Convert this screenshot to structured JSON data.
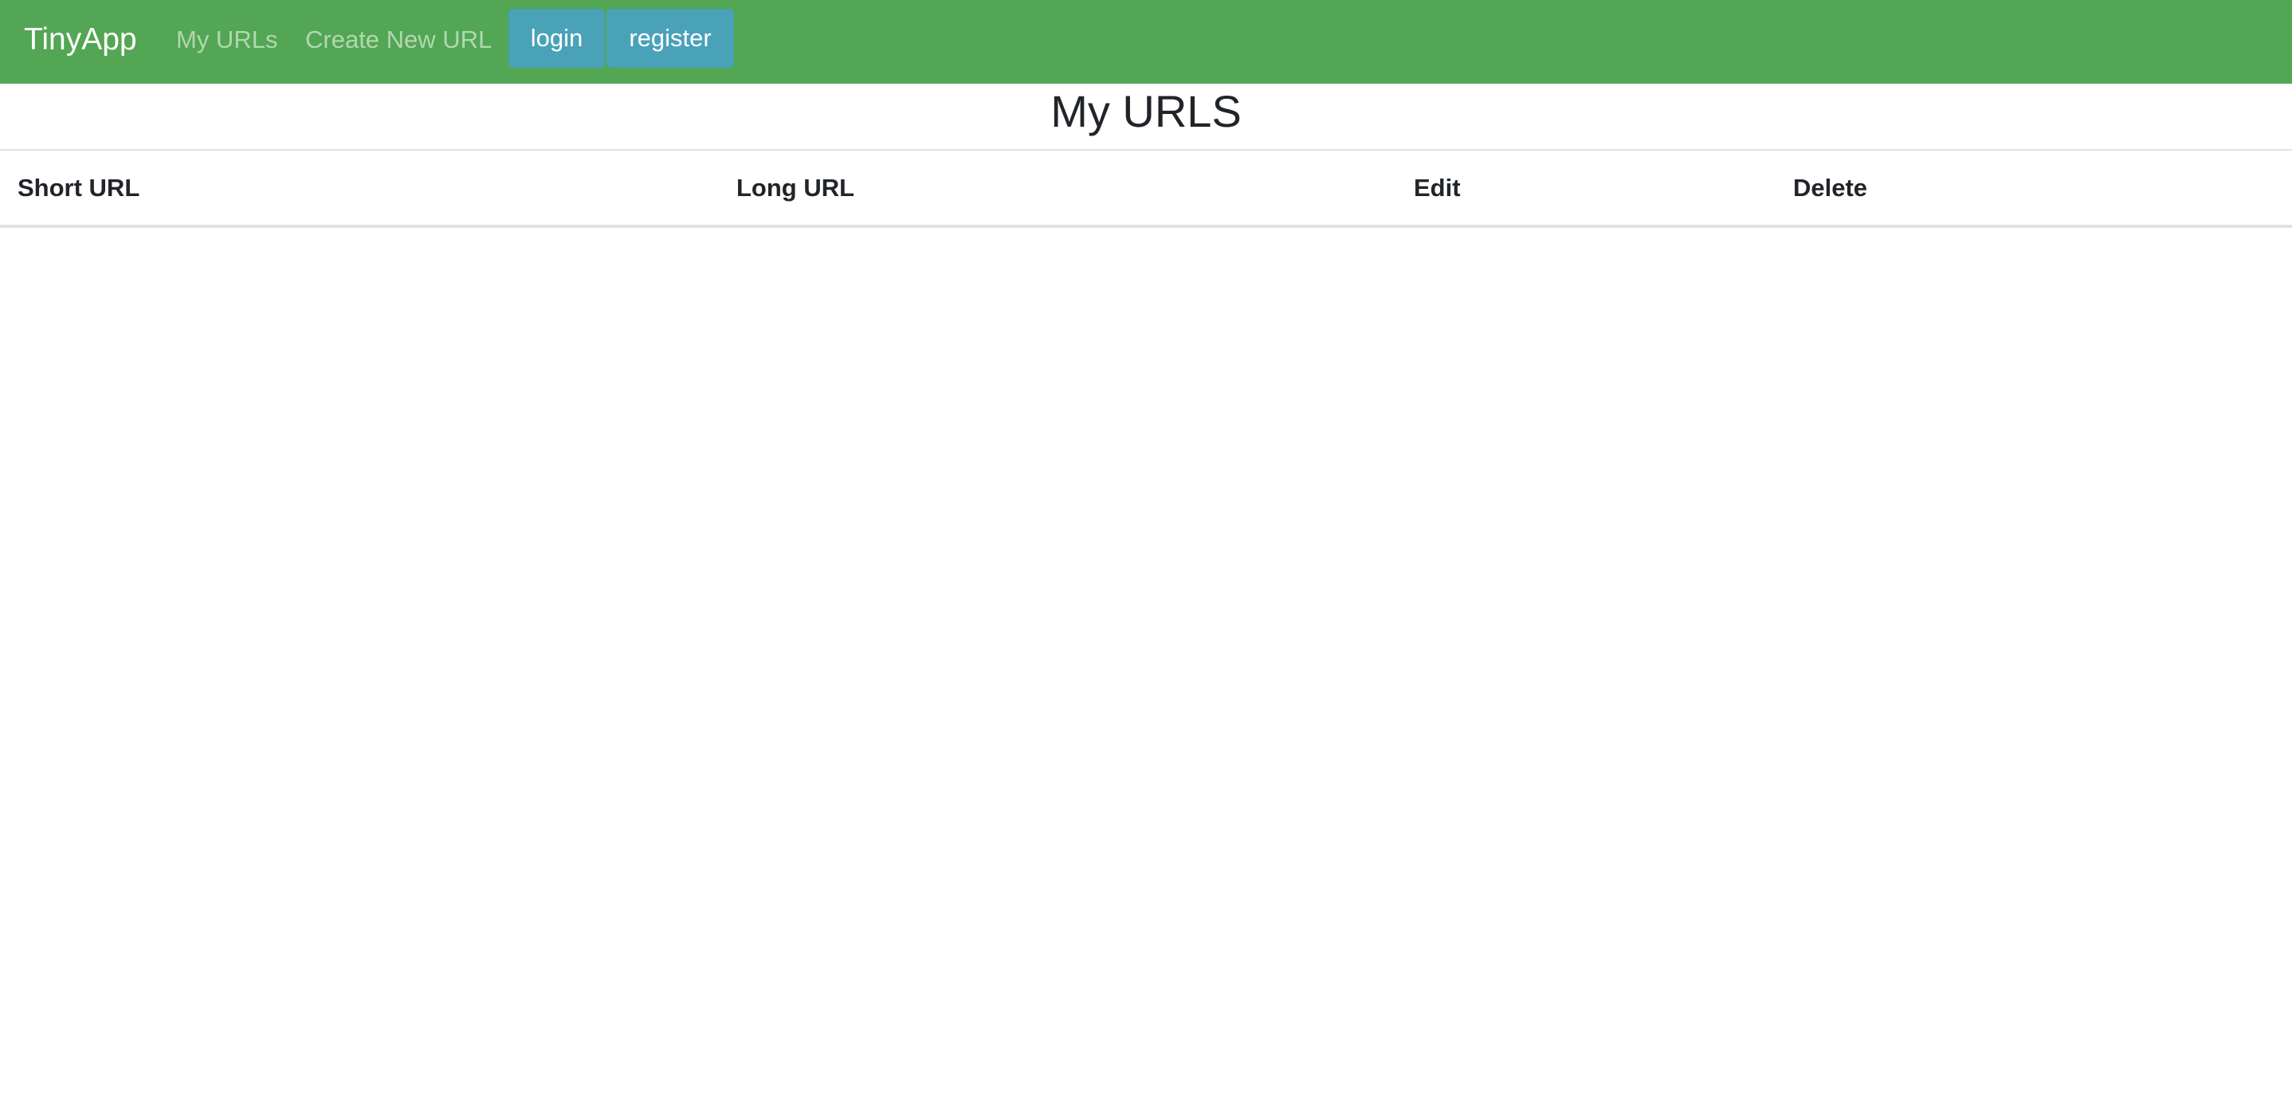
{
  "navbar": {
    "brand": "TinyApp",
    "links": {
      "my_urls": "My URLs",
      "create_new_url": "Create New URL"
    },
    "buttons": {
      "login": "login",
      "register": "register"
    },
    "colors": {
      "background": "#53a653",
      "button": "#4aa2b8"
    }
  },
  "main": {
    "title": "My URLS",
    "table": {
      "headers": {
        "short_url": "Short URL",
        "long_url": "Long URL",
        "edit": "Edit",
        "delete": "Delete"
      },
      "rows": []
    }
  }
}
